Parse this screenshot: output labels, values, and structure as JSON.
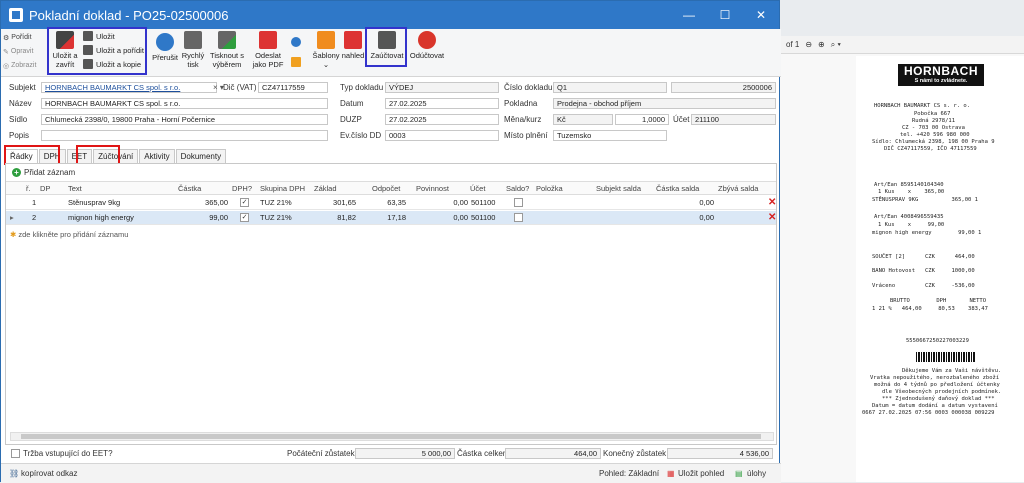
{
  "window": {
    "title": "Pokladní doklad - PO25-02500006"
  },
  "bg_app": {
    "side_items": [
      "Pořídit",
      "Opravit",
      "Zobrazit"
    ]
  },
  "ribbon": {
    "save_close": "Uložit a zavřít",
    "save": "Uložit",
    "save_new": "Uložit a pořídit",
    "save_copy": "Uložit a kopie",
    "interrupt": "Přerušit",
    "quick_print": "Rychlý tisk",
    "print_select": "Tisknout s výběrem",
    "send_pdf": "Odeslat jako PDF",
    "templates": "Šablony",
    "preview": "nahled",
    "post": "Zaúčtovat",
    "unpost": "Odúčtovat"
  },
  "form": {
    "subject_label": "Subjekt",
    "subject_value": "HORNBACH BAUMARKT CS spol. s r.o.",
    "vat_label": "Dič (VAT)",
    "vat_value": "CZ47117559",
    "name_label": "Název",
    "name_value": "HORNBACH BAUMARKT CS spol. s r.o.",
    "address_label": "Sídlo",
    "address_value": "Chlumecká 2398/0, 19800 Praha - Horní Počernice",
    "desc_label": "Popis",
    "desc_value": "",
    "doc_type_label": "Typ dokladu",
    "doc_type_value": "VÝDEJ",
    "date_label": "Datum",
    "date_value": "27.02.2025",
    "duzp_label": "DUZP",
    "duzp_value": "27.02.2025",
    "ev_label": "Ev.číslo DD",
    "ev_value": "0003",
    "docnum_label": "Číslo dokladu",
    "docnum_series": "Q1",
    "docnum_value": "2500006",
    "cash_label": "Pokladna",
    "cash_value": "Prodejna - obchod příjem",
    "currency_label": "Měna/kurz",
    "currency_value": "Kč",
    "rate_value": "1,0000",
    "account_label": "Účet",
    "account_value": "211100",
    "place_label": "Místo plnění",
    "place_value": "Tuzemsko"
  },
  "tabs": [
    "Řádky",
    "DPH",
    "EET",
    "Zúčtování",
    "Aktivity",
    "Dokumenty"
  ],
  "grid": {
    "add_label": "Přidat záznam",
    "columns": [
      "ř.",
      "DP",
      "Text",
      "Částka",
      "DPH?",
      "Skupina DPH",
      "Základ",
      "Odpočet",
      "Povinnost",
      "Účet",
      "Saldo?",
      "Položka",
      "Subjekt salda",
      "Částka salda",
      "Zbývá salda"
    ],
    "rows": [
      {
        "n": "1",
        "text": "Stěnusprav 9kg",
        "amount": "365,00",
        "vat_group": "TUZ 21%",
        "base": "301,65",
        "deduct": "63,35",
        "duty": "0,00",
        "account": "501100",
        "saldo_amount": "0,00"
      },
      {
        "n": "2",
        "text": "mignon high energy",
        "amount": "99,00",
        "vat_group": "TUZ 21%",
        "base": "81,82",
        "deduct": "17,18",
        "duty": "0,00",
        "account": "501100",
        "saldo_amount": "0,00"
      }
    ],
    "new_row_hint": "zde klikněte pro přidání záznamu"
  },
  "footer": {
    "eet_label": "Tržba vstupující do EET?",
    "start_label": "Počáteční zůstatek",
    "start_value": "5 000,00",
    "total_label": "Částka celkem",
    "total_value": "464,00",
    "end_label": "Konečný zůstatek",
    "end_value": "4 536,00"
  },
  "statusbar": {
    "copy_link": "kopírovat odkaz",
    "view": "Pohled: Základní",
    "save_view": "Uložit pohled",
    "tasks": "úlohy"
  },
  "pdf": {
    "page": "of 1",
    "receipt_lines": [
      "HORNBACH BAUMARKT CS s. r. o.",
      "Pobočka 667",
      "Rudná 2978/11",
      "CZ - 703 00 Ostrava",
      "tel. +420 596 980 000",
      "Sídlo: Chlumecká 2398, 198 00 Praha 9",
      "DIČ CZ47117559, IČO 47117559",
      "Art/Ean 8595140104340",
      "1 Kus    x    365,00",
      "STĚNUSPRAV 9KG          365,00 1",
      "Art/Ean 4008496559435",
      "1 Kus    x     99,00",
      "mignon high energy        99,00 1",
      "SOUČET [2]      CZK      464,00",
      "BANO Hotovost   CZK     1000,00",
      "Vráceno         CZK     -536,00",
      "BRUTTO        DPH       NETTO",
      "1 21 %   464,00     80,53    383,47",
      "5550667250227003229",
      "Děkujeme Vám za Vaši návštěvu.",
      "Vratka nepoužitého, nerozbaleného zboží",
      "možná do 4 týdnů po předložení účtenky",
      "dle Všeobecných prodejních podmínek.",
      "*** Zjednodušený daňový doklad ***",
      "Datum = datum dodání a datum vystavení",
      "0667 27.02.2025 07:56 0003 000038 009229"
    ],
    "logo_main": "HORNBACH",
    "logo_tag": "S námi to zvládnete."
  }
}
